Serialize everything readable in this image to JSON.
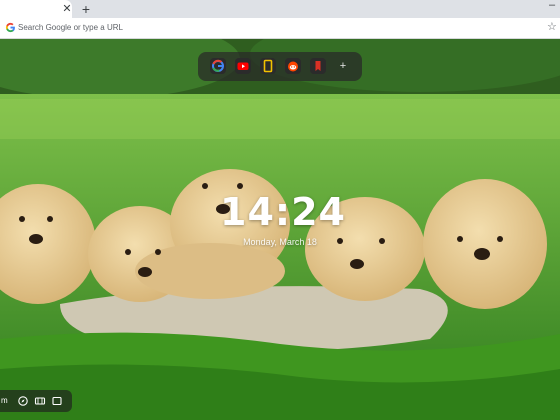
{
  "tab": {
    "close_label": "✕"
  },
  "tabstrip": {
    "new_tab_label": "+",
    "minimize_label": "–"
  },
  "omnibox": {
    "placeholder": "Search Google or type a URL",
    "value": ""
  },
  "shortcuts": [
    {
      "name": "google",
      "icon": "google-icon"
    },
    {
      "name": "youtube",
      "icon": "youtube-icon"
    },
    {
      "name": "notes",
      "icon": "note-icon"
    },
    {
      "name": "reddit",
      "icon": "reddit-icon"
    },
    {
      "name": "bookmark",
      "icon": "bookmark-icon"
    }
  ],
  "shortcut_add_label": "+",
  "clock": {
    "time": "14:24",
    "date": "Monday, March 18"
  },
  "dock": {
    "label": "m"
  },
  "colors": {
    "accent_youtube": "#ff0000",
    "accent_notes": "#f2c200",
    "accent_reddit": "#ff4500",
    "accent_bookmark": "#d93025"
  }
}
